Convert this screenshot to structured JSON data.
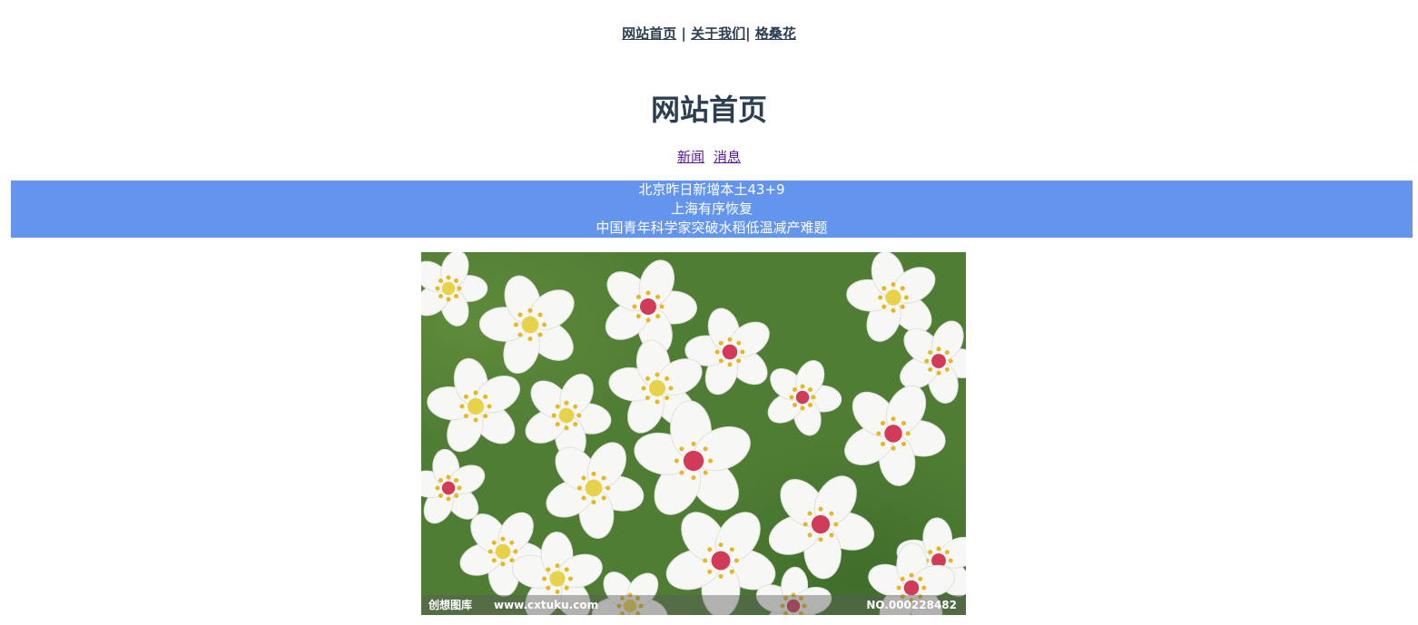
{
  "top_nav": {
    "home": "网站首页",
    "sep1": " | ",
    "about": "关于我们",
    "sep2": "| ",
    "flower": "格桑花"
  },
  "page_title": "网站首页",
  "sub_nav": {
    "news": "新闻",
    "messages": "消息"
  },
  "news_items": [
    "北京昨日新增本土43+9",
    "上海有序恢复",
    "中国青年科学家突破水稻低温减产难题"
  ],
  "image": {
    "watermark_left": "创想图库",
    "watermark_middle": "www.cxtuku.com",
    "watermark_right": "NO.000228482"
  },
  "colors": {
    "heading": "#2c3e50",
    "news_bg": "#6495ed",
    "visited_link": "#551a8b"
  }
}
